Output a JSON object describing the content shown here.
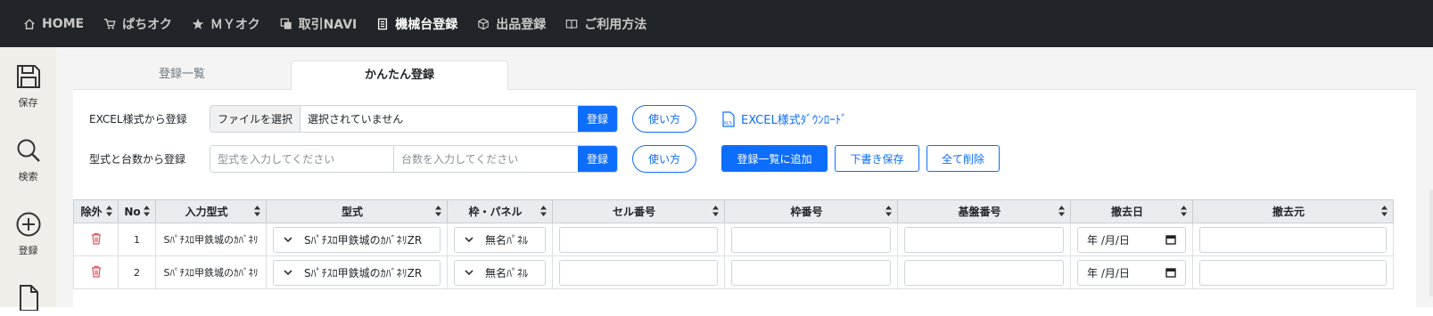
{
  "nav": {
    "items": [
      {
        "label": "HOME",
        "icon": "home-icon"
      },
      {
        "label": "ぱちオク",
        "icon": "cart-icon"
      },
      {
        "label": "ＭＹオク",
        "icon": "star-icon"
      },
      {
        "label": "取引NAVI",
        "icon": "copy-icon"
      },
      {
        "label": "機械台登録",
        "icon": "document-icon"
      },
      {
        "label": "出品登録",
        "icon": "box-icon"
      },
      {
        "label": "ご利用方法",
        "icon": "book-icon"
      }
    ],
    "active_index": 4
  },
  "sidebar": {
    "items": [
      {
        "label": "保存",
        "icon": "floppy-disk-icon"
      },
      {
        "label": "検索",
        "icon": "search-icon"
      },
      {
        "label": "登録",
        "icon": "plus-circle-icon"
      },
      {
        "label": "",
        "icon": "file-icon"
      }
    ]
  },
  "tabs": [
    {
      "label": "登録一覧"
    },
    {
      "label": "かんたん登録"
    }
  ],
  "excel_row": {
    "label": "EXCEL様式から登録",
    "file_button": "ファイルを選択",
    "file_status": "選択されていません",
    "submit": "登録",
    "help": "使い方",
    "download": "EXCEL様式ﾀﾞｳﾝﾛｰﾄﾞ"
  },
  "model_row": {
    "label": "型式と台数から登録",
    "model_placeholder": "型式を入力してください",
    "count_placeholder": "台数を入力してください",
    "submit": "登録",
    "help": "使い方",
    "add_button": "登録一覧に追加",
    "draft_button": "下書き保存",
    "delete_all_button": "全て削除"
  },
  "table": {
    "headers": [
      "除外",
      "No",
      "入力型式",
      "型式",
      "枠・パネル",
      "セル番号",
      "枠番号",
      "基盤番号",
      "撤去日",
      "撤去元"
    ],
    "rows": [
      {
        "no": "1",
        "input_model": "Sﾊﾟﾁｽﾛ甲鉄城のｶﾊﾞﾈﾘ",
        "model": "Sﾊﾟﾁｽﾛ甲鉄城のｶﾊﾞﾈﾘZR",
        "panel": "無名ﾊﾟﾈﾙ",
        "date": "年 /月/日"
      },
      {
        "no": "2",
        "input_model": "Sﾊﾟﾁｽﾛ甲鉄城のｶﾊﾞﾈﾘ",
        "model": "Sﾊﾟﾁｽﾛ甲鉄城のｶﾊﾞﾈﾘZR",
        "panel": "無名ﾊﾟﾈﾙ",
        "date": "年 /月/日"
      }
    ]
  },
  "colors": {
    "primary": "#0d6efd",
    "nav_bg": "#212529",
    "sidebar_bg": "#efeee8",
    "trash": "#e0555a"
  }
}
